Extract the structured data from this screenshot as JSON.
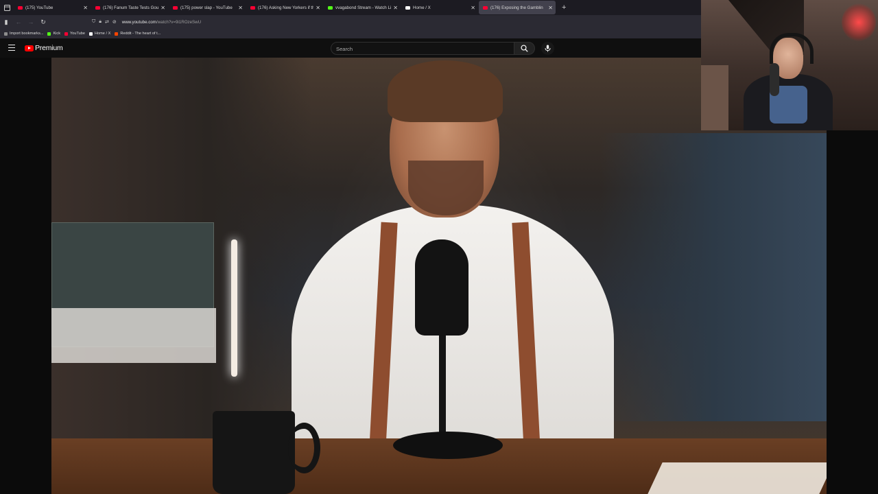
{
  "browser": {
    "tabs": [
      {
        "title": "(175) YouTube",
        "favicon_color": "#ff0033",
        "active": false
      },
      {
        "title": "(176) Fanum Taste Tests Gourm",
        "favicon_color": "#ff0033",
        "active": false
      },
      {
        "title": "(175) power slap - YouTube",
        "favicon_color": "#ff0033",
        "active": false
      },
      {
        "title": "(176) Asking New Yorkers if the",
        "favicon_color": "#ff0033",
        "active": false
      },
      {
        "title": "vvagabond Stream - Watch Liv",
        "favicon_color": "#53fc18",
        "active": false
      },
      {
        "title": "Home / X",
        "favicon_color": "#ffffff",
        "active": false
      },
      {
        "title": "(176) Exposing the Gamblin",
        "favicon_color": "#ff0033",
        "active": true
      }
    ],
    "new_tab_label": "+",
    "url_domain": "www.youtube.com",
    "url_path": "/watch?v=9i1ROzeSwU",
    "bookmarks": [
      {
        "label": "Import bookmarks...",
        "icon_color": "#8d8d8d"
      },
      {
        "label": "Kick",
        "icon_color": "#53fc18"
      },
      {
        "label": "YouTube",
        "icon_color": "#ff0033"
      },
      {
        "label": "Home / X",
        "icon_color": "#ffffff"
      },
      {
        "label": "Reddit - The heart of t...",
        "icon_color": "#ff4500"
      }
    ]
  },
  "youtube": {
    "logo_text": "Premium",
    "search_placeholder": "Search"
  },
  "colors": {
    "youtube_red": "#ff0000",
    "tabbar_bg": "#1c1b22",
    "navbar_bg": "#2b2a33",
    "page_bg": "#0f0f0f"
  },
  "icons": [
    "menu-icon",
    "back-icon",
    "forward-icon",
    "reload-icon",
    "shield-icon",
    "lock-icon",
    "hamburger-icon",
    "search-icon",
    "microphone-icon",
    "close-icon",
    "new-tab-icon"
  ]
}
